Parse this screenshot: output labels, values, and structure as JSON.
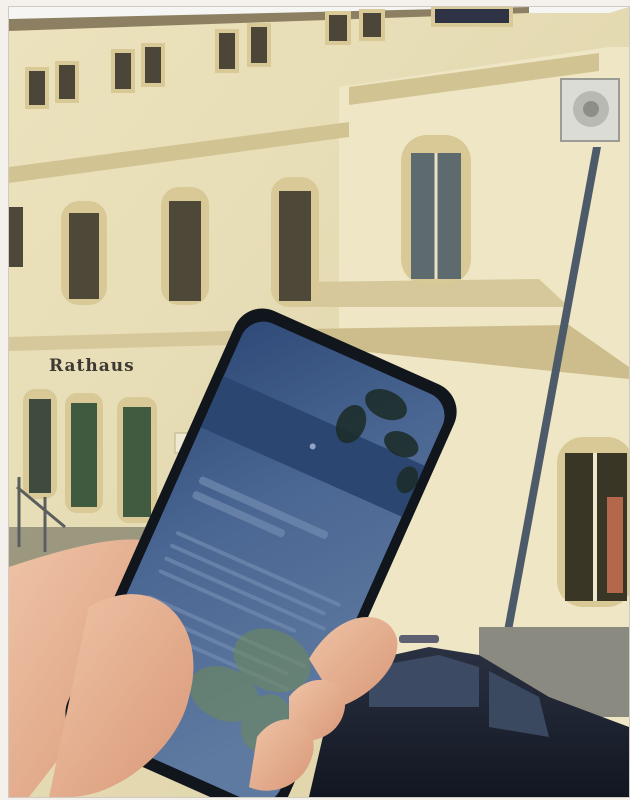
{
  "photo": {
    "subject_colors": {
      "facade": "#e7ddb4",
      "trim": "#d6c796",
      "sky": "#f5f6f4",
      "phone_screen": "#3d5a86",
      "car": "#1c2230",
      "hand": "#e8b495"
    }
  },
  "building_sign": {
    "text": "Rathaus"
  }
}
